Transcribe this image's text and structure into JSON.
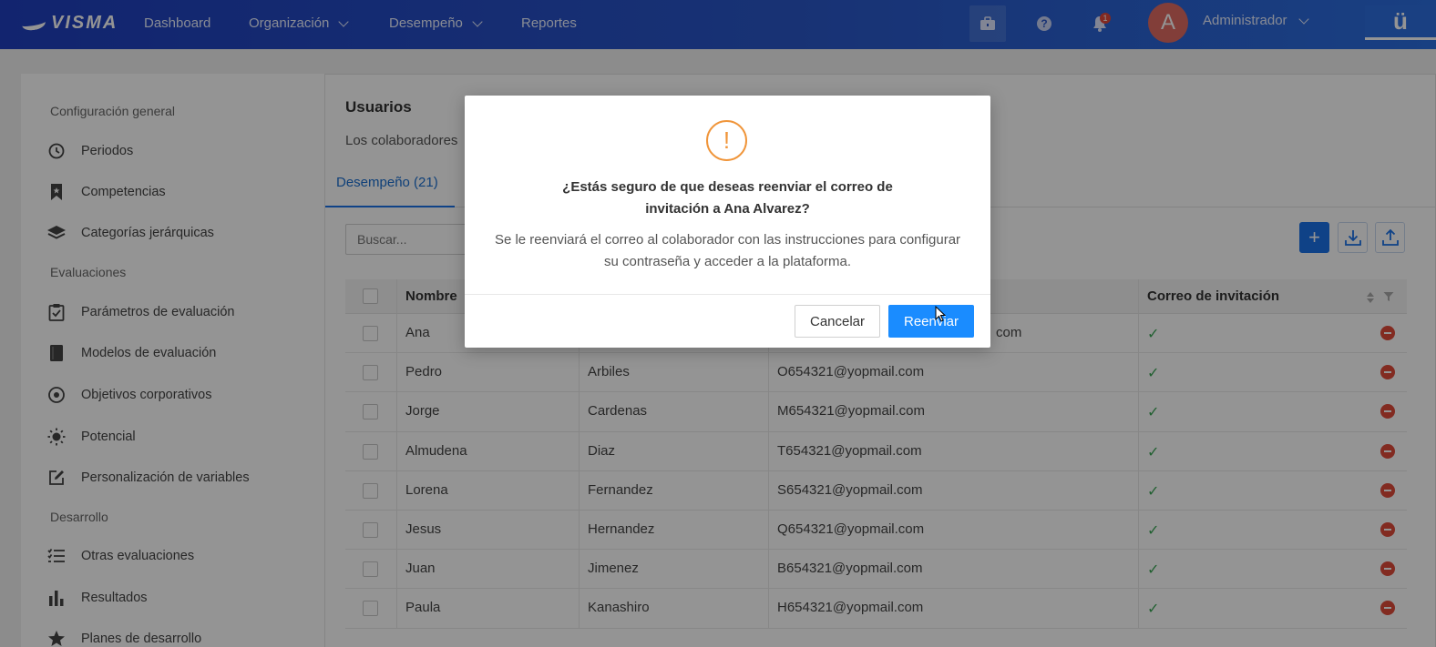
{
  "nav": {
    "brand": "VISMA",
    "items": [
      "Dashboard",
      "Organización",
      "Desempeño",
      "Reportes"
    ],
    "notification_count": "1",
    "avatar_letter": "A",
    "user_name": "Administrador",
    "brand_button": "ü"
  },
  "sidebar": {
    "sections": [
      {
        "title": "Configuración general",
        "items": [
          "Periodos",
          "Competencias",
          "Categorías jerárquicas"
        ]
      },
      {
        "title": "Evaluaciones",
        "items": [
          "Parámetros de evaluación",
          "Modelos de evaluación",
          "Objetivos corporativos",
          "Potencial",
          "Personalización de variables"
        ]
      },
      {
        "title": "Desarrollo",
        "items": [
          "Otras evaluaciones",
          "Resultados",
          "Planes de desarrollo"
        ]
      }
    ]
  },
  "main": {
    "title": "Usuarios",
    "subtitle": "Los colaboradores",
    "tab_label": "Desempeño (21)",
    "search_placeholder": "Buscar...",
    "columns": {
      "name": "Nombre",
      "invite": "Correo de invitación"
    },
    "rows": [
      {
        "first": "Ana",
        "last": "",
        "email": "com"
      },
      {
        "first": "Pedro",
        "last": "Arbiles",
        "email": "O654321@yopmail.com"
      },
      {
        "first": "Jorge",
        "last": "Cardenas",
        "email": "M654321@yopmail.com"
      },
      {
        "first": "Almudena",
        "last": "Diaz",
        "email": "T654321@yopmail.com"
      },
      {
        "first": "Lorena",
        "last": "Fernandez",
        "email": "S654321@yopmail.com"
      },
      {
        "first": "Jesus",
        "last": "Hernandez",
        "email": "Q654321@yopmail.com"
      },
      {
        "first": "Juan",
        "last": "Jimenez",
        "email": "B654321@yopmail.com"
      },
      {
        "first": "Paula",
        "last": "Kanashiro",
        "email": "H654321@yopmail.com"
      }
    ]
  },
  "modal": {
    "title_line1": "¿Estás seguro de que deseas reenviar el correo de",
    "title_line2": "invitación a Ana Alvarez?",
    "body_line1": "Se le reenviará el correo al colaborador con las instrucciones para configurar",
    "body_line2": "su contraseña y acceder a la plataforma.",
    "cancel": "Cancelar",
    "confirm": "Reenviar"
  },
  "colors": {
    "primary": "#1a8cff",
    "warning": "#f0953a",
    "danger": "#e04a3a",
    "success": "#3aa655"
  }
}
